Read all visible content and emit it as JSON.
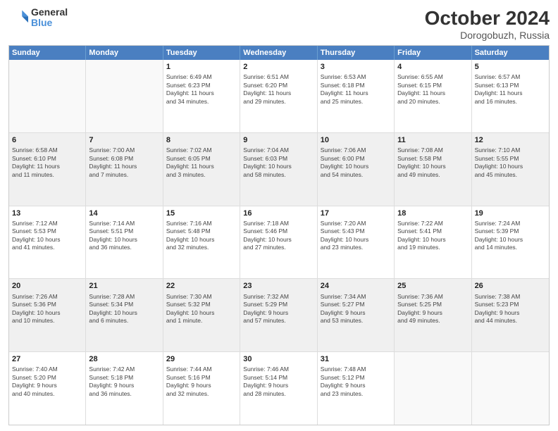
{
  "header": {
    "logo": {
      "general": "General",
      "blue": "Blue"
    },
    "title": "October 2024",
    "location": "Dorogobuzh, Russia"
  },
  "weekdays": [
    "Sunday",
    "Monday",
    "Tuesday",
    "Wednesday",
    "Thursday",
    "Friday",
    "Saturday"
  ],
  "rows": [
    [
      {
        "day": "",
        "empty": true,
        "content": ""
      },
      {
        "day": "",
        "empty": true,
        "content": ""
      },
      {
        "day": "1",
        "content": "Sunrise: 6:49 AM\nSunset: 6:23 PM\nDaylight: 11 hours\nand 34 minutes."
      },
      {
        "day": "2",
        "content": "Sunrise: 6:51 AM\nSunset: 6:20 PM\nDaylight: 11 hours\nand 29 minutes."
      },
      {
        "day": "3",
        "content": "Sunrise: 6:53 AM\nSunset: 6:18 PM\nDaylight: 11 hours\nand 25 minutes."
      },
      {
        "day": "4",
        "content": "Sunrise: 6:55 AM\nSunset: 6:15 PM\nDaylight: 11 hours\nand 20 minutes."
      },
      {
        "day": "5",
        "content": "Sunrise: 6:57 AM\nSunset: 6:13 PM\nDaylight: 11 hours\nand 16 minutes."
      }
    ],
    [
      {
        "day": "6",
        "shaded": true,
        "content": "Sunrise: 6:58 AM\nSunset: 6:10 PM\nDaylight: 11 hours\nand 11 minutes."
      },
      {
        "day": "7",
        "shaded": true,
        "content": "Sunrise: 7:00 AM\nSunset: 6:08 PM\nDaylight: 11 hours\nand 7 minutes."
      },
      {
        "day": "8",
        "shaded": true,
        "content": "Sunrise: 7:02 AM\nSunset: 6:05 PM\nDaylight: 11 hours\nand 3 minutes."
      },
      {
        "day": "9",
        "shaded": true,
        "content": "Sunrise: 7:04 AM\nSunset: 6:03 PM\nDaylight: 10 hours\nand 58 minutes."
      },
      {
        "day": "10",
        "shaded": true,
        "content": "Sunrise: 7:06 AM\nSunset: 6:00 PM\nDaylight: 10 hours\nand 54 minutes."
      },
      {
        "day": "11",
        "shaded": true,
        "content": "Sunrise: 7:08 AM\nSunset: 5:58 PM\nDaylight: 10 hours\nand 49 minutes."
      },
      {
        "day": "12",
        "shaded": true,
        "content": "Sunrise: 7:10 AM\nSunset: 5:55 PM\nDaylight: 10 hours\nand 45 minutes."
      }
    ],
    [
      {
        "day": "13",
        "content": "Sunrise: 7:12 AM\nSunset: 5:53 PM\nDaylight: 10 hours\nand 41 minutes."
      },
      {
        "day": "14",
        "content": "Sunrise: 7:14 AM\nSunset: 5:51 PM\nDaylight: 10 hours\nand 36 minutes."
      },
      {
        "day": "15",
        "content": "Sunrise: 7:16 AM\nSunset: 5:48 PM\nDaylight: 10 hours\nand 32 minutes."
      },
      {
        "day": "16",
        "content": "Sunrise: 7:18 AM\nSunset: 5:46 PM\nDaylight: 10 hours\nand 27 minutes."
      },
      {
        "day": "17",
        "content": "Sunrise: 7:20 AM\nSunset: 5:43 PM\nDaylight: 10 hours\nand 23 minutes."
      },
      {
        "day": "18",
        "content": "Sunrise: 7:22 AM\nSunset: 5:41 PM\nDaylight: 10 hours\nand 19 minutes."
      },
      {
        "day": "19",
        "content": "Sunrise: 7:24 AM\nSunset: 5:39 PM\nDaylight: 10 hours\nand 14 minutes."
      }
    ],
    [
      {
        "day": "20",
        "shaded": true,
        "content": "Sunrise: 7:26 AM\nSunset: 5:36 PM\nDaylight: 10 hours\nand 10 minutes."
      },
      {
        "day": "21",
        "shaded": true,
        "content": "Sunrise: 7:28 AM\nSunset: 5:34 PM\nDaylight: 10 hours\nand 6 minutes."
      },
      {
        "day": "22",
        "shaded": true,
        "content": "Sunrise: 7:30 AM\nSunset: 5:32 PM\nDaylight: 10 hours\nand 1 minute."
      },
      {
        "day": "23",
        "shaded": true,
        "content": "Sunrise: 7:32 AM\nSunset: 5:29 PM\nDaylight: 9 hours\nand 57 minutes."
      },
      {
        "day": "24",
        "shaded": true,
        "content": "Sunrise: 7:34 AM\nSunset: 5:27 PM\nDaylight: 9 hours\nand 53 minutes."
      },
      {
        "day": "25",
        "shaded": true,
        "content": "Sunrise: 7:36 AM\nSunset: 5:25 PM\nDaylight: 9 hours\nand 49 minutes."
      },
      {
        "day": "26",
        "shaded": true,
        "content": "Sunrise: 7:38 AM\nSunset: 5:23 PM\nDaylight: 9 hours\nand 44 minutes."
      }
    ],
    [
      {
        "day": "27",
        "content": "Sunrise: 7:40 AM\nSunset: 5:20 PM\nDaylight: 9 hours\nand 40 minutes."
      },
      {
        "day": "28",
        "content": "Sunrise: 7:42 AM\nSunset: 5:18 PM\nDaylight: 9 hours\nand 36 minutes."
      },
      {
        "day": "29",
        "content": "Sunrise: 7:44 AM\nSunset: 5:16 PM\nDaylight: 9 hours\nand 32 minutes."
      },
      {
        "day": "30",
        "content": "Sunrise: 7:46 AM\nSunset: 5:14 PM\nDaylight: 9 hours\nand 28 minutes."
      },
      {
        "day": "31",
        "content": "Sunrise: 7:48 AM\nSunset: 5:12 PM\nDaylight: 9 hours\nand 23 minutes."
      },
      {
        "day": "",
        "empty": true,
        "content": ""
      },
      {
        "day": "",
        "empty": true,
        "content": ""
      }
    ]
  ]
}
